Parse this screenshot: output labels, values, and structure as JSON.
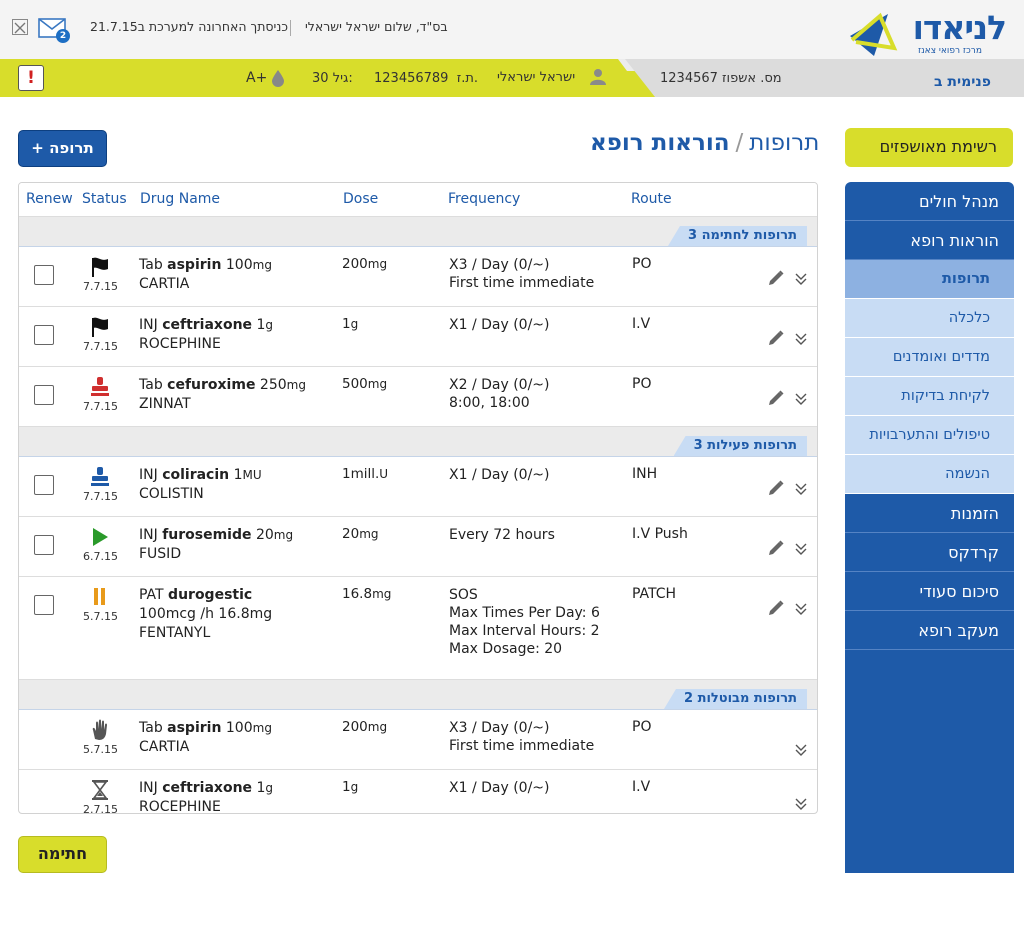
{
  "header": {
    "logo_text": "לניאדו",
    "logo_sub": "מרכז רפואי צאנז",
    "greeting": "בס\"ד, שלום ישראל ישראלי",
    "last_login": "כניסתך האחרונה למערכת ב21.7.15",
    "mail_count": "2"
  },
  "patient": {
    "ward": "פנימית ב",
    "admission": "מס. אשפוז 1234567",
    "name": "ישראל ישראלי",
    "id_label": "ת.ז.",
    "id_value": "123456789",
    "age_label": "גיל:",
    "age_value": "30",
    "blood": "A+",
    "alert": "!"
  },
  "sidebar": {
    "admitted_list": "רשימת מאושפזים",
    "items": [
      {
        "label": "מנהל חולים"
      },
      {
        "label": "הוראות רופא"
      },
      {
        "label": "תרופות",
        "sub": true,
        "active": true
      },
      {
        "label": "כלכלה",
        "sub": true
      },
      {
        "label": "מדדים ואומדנים",
        "sub": true
      },
      {
        "label": "לקיחת בדיקות",
        "sub": true
      },
      {
        "label": "טיפולים והתערבויות",
        "sub": true
      },
      {
        "label": "הנשמה",
        "sub": true
      },
      {
        "label": "הזמנות"
      },
      {
        "label": "קרדקס"
      },
      {
        "label": "סיכום סעודי"
      },
      {
        "label": "מעקב רופא"
      }
    ]
  },
  "page": {
    "title": "הוראות רופא",
    "separator": "/",
    "subtitle": "תרופות",
    "add_button": "+ תרופה",
    "sign_button": "חתימה"
  },
  "table": {
    "columns": {
      "renew": "Renew",
      "status": "Status",
      "drug": "Drug Name",
      "dose": "Dose",
      "frequency": "Frequency",
      "route": "Route"
    },
    "groups": [
      {
        "label": "3 תרופות לחתימה",
        "rows": [
          {
            "status_icon": "flag-icon",
            "date": "7.7.15",
            "form": "Tab",
            "drug": "aspirin",
            "strength": "100",
            "strength_unit": "mg",
            "brand": "CARTIA",
            "dose": "200",
            "dose_unit": "mg",
            "freq": [
              "X3 / Day (0/~)",
              "First time immediate"
            ],
            "route": "PO",
            "editable": true
          },
          {
            "status_icon": "flag-icon",
            "date": "7.7.15",
            "form": "INJ",
            "drug": "ceftriaxone",
            "strength": "1",
            "strength_unit": "g",
            "brand": "ROCEPHINE",
            "dose": "1",
            "dose_unit": "g",
            "freq": [
              "X1 / Day (0/~)"
            ],
            "route": "I.V",
            "editable": true
          },
          {
            "status_icon": "stamp-red-icon",
            "date": "7.7.15",
            "form": "Tab",
            "drug": "cefuroxime",
            "strength": "250",
            "strength_unit": "mg",
            "brand": "ZINNAT",
            "dose": "500",
            "dose_unit": "mg",
            "freq": [
              "X2 / Day (0/~)",
              "8:00, 18:00"
            ],
            "route": "PO",
            "editable": true
          }
        ]
      },
      {
        "label": "3 תרופות פעילות",
        "rows": [
          {
            "status_icon": "stamp-blue-icon",
            "date": "7.7.15",
            "form": "INJ",
            "drug": "coliracin",
            "strength": "1",
            "strength_unit": "MU",
            "brand": "COLISTIN",
            "dose": "1mill.",
            "dose_unit": "U",
            "freq": [
              "X1 / Day (0/~)"
            ],
            "route": "INH",
            "editable": true
          },
          {
            "status_icon": "play-icon",
            "date": "6.7.15",
            "form": "INJ",
            "drug": "furosemide",
            "strength": "20",
            "strength_unit": "mg",
            "brand": "FUSID",
            "dose": "20",
            "dose_unit": "mg",
            "freq": [
              "Every 72 hours"
            ],
            "route": "I.V Push",
            "editable": true
          },
          {
            "status_icon": "pause-icon",
            "date": "5.7.15",
            "form": "PAT",
            "drug": "durogestic",
            "strength_line": "100mcg /h 16.8mg",
            "brand": "FENTANYL",
            "dose": "16.8",
            "dose_unit": "mg",
            "freq": [
              "SOS",
              "Max Times Per Day: 6",
              "Max Interval Hours: 2",
              "Max Dosage: 20"
            ],
            "route": "PATCH",
            "editable": true
          }
        ]
      },
      {
        "label": "2 תרופות מבוטלות",
        "rows": [
          {
            "status_icon": "hand-icon",
            "date": "5.7.15",
            "form": "Tab",
            "drug": "aspirin",
            "strength": "100",
            "strength_unit": "mg",
            "brand": "CARTIA",
            "dose": "200",
            "dose_unit": "mg",
            "freq": [
              "X3 / Day (0/~)",
              "First time immediate"
            ],
            "route": "PO",
            "editable": false
          },
          {
            "status_icon": "hourglass-icon",
            "date": "2.7.15",
            "form": "INJ",
            "drug": "ceftriaxone",
            "strength": "1",
            "strength_unit": "g",
            "brand": "ROCEPHINE",
            "dose": "1",
            "dose_unit": "g",
            "freq": [
              "X1 / Day (0/~)"
            ],
            "route": "I.V",
            "editable": false
          }
        ]
      }
    ]
  }
}
